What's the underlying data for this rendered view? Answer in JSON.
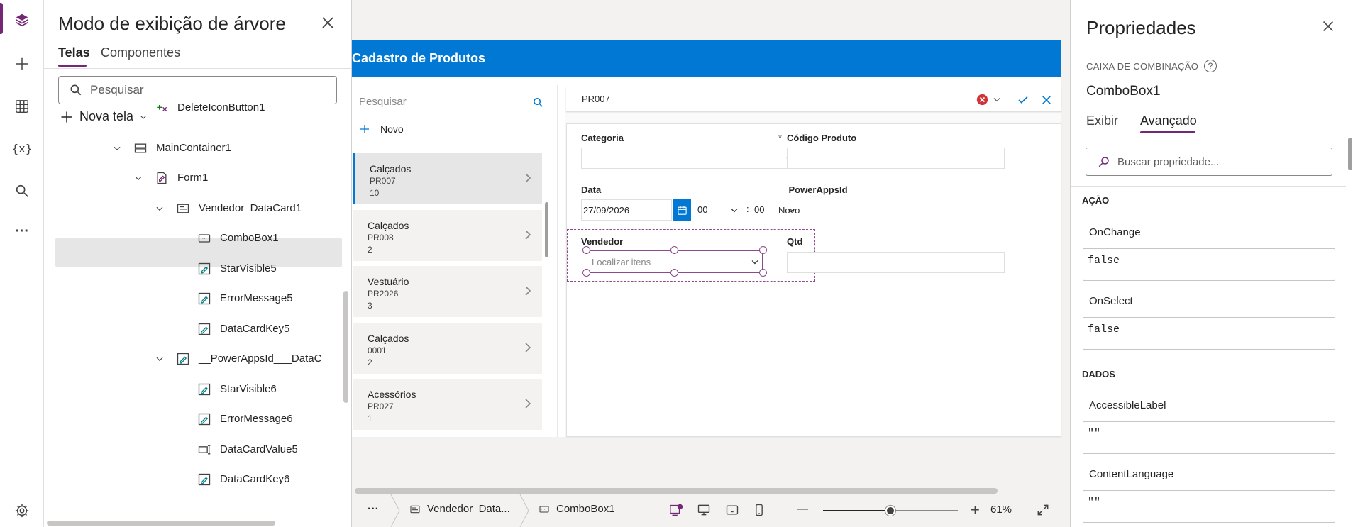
{
  "rail": {
    "icons": [
      "layers-icon",
      "plus-icon",
      "table-icon",
      "variable-icon",
      "search-icon",
      "more-icon",
      "settings-icon"
    ],
    "variable_label": "{x}",
    "more_label": "···"
  },
  "tree": {
    "title": "Modo de exibição de árvore",
    "tabs": [
      "Telas",
      "Componentes"
    ],
    "active_tab": "Telas",
    "search_placeholder": "Pesquisar",
    "new_screen": "Nova tela",
    "rows": [
      {
        "label": "DeleteIconButton1",
        "level": 7
      },
      {
        "label": "MainContainer1",
        "level": 6
      },
      {
        "label": "Form1",
        "level": 7
      },
      {
        "label": "Vendedor_DataCard1",
        "level": 8
      },
      {
        "label": "ComboBox1",
        "level": 9,
        "selected": true
      },
      {
        "label": "StarVisible5",
        "level": 9
      },
      {
        "label": "ErrorMessage5",
        "level": 9
      },
      {
        "label": "DataCardKey5",
        "level": 9
      },
      {
        "label": "__PowerAppsId___DataC",
        "level": 8
      },
      {
        "label": "StarVisible6",
        "level": 9
      },
      {
        "label": "ErrorMessage6",
        "level": 9
      },
      {
        "label": "DataCardValue5",
        "level": 9
      },
      {
        "label": "DataCardKey6",
        "level": 9
      }
    ]
  },
  "app_screen": {
    "header": "Cadastro de Produtos",
    "list_search_placeholder": "Pesquisar",
    "new_label": "Novo",
    "items": [
      {
        "title": "Calçados",
        "code": "PR007",
        "qty": "10"
      },
      {
        "title": "Calçados",
        "code": "PR008",
        "qty": "2"
      },
      {
        "title": "Vestuário",
        "code": "PR2026",
        "qty": "3"
      },
      {
        "title": "Calçados",
        "code": "0001",
        "qty": "2"
      },
      {
        "title": "Acessórios",
        "code": "PR027",
        "qty": "1"
      }
    ],
    "key_value": "PR007",
    "form": {
      "categoria_label": "Categoria",
      "codigo_label": "Código Produto",
      "required_mark": "*",
      "data_label": "Data",
      "date_value": "27/09/2026",
      "hour_value": "00",
      "minute_value": "00",
      "time_sep": ":",
      "powerappsid_label": "__PowerAppsId__",
      "powerappsid_value": "Novo",
      "vendedor_label": "Vendedor",
      "combo_placeholder": "Localizar itens",
      "qtd_label": "Qtd"
    }
  },
  "bottom_bar": {
    "more": "···",
    "breadcrumb": [
      "Vendedor_Data...",
      "ComboBox1"
    ],
    "zoom_minus": "—",
    "zoom_plus": "+",
    "zoom": "61%",
    "zoom_level_fraction": 0.5
  },
  "properties": {
    "title": "Propriedades",
    "type": "CAIXA DE COMBINAÇÃO",
    "help": "?",
    "name": "ComboBox1",
    "tabs": [
      "Exibir",
      "Avançado"
    ],
    "active_tab": "Avançado",
    "search_placeholder": "Buscar propriedade...",
    "sections": [
      {
        "name": "AÇÃO",
        "props": [
          {
            "label": "OnChange",
            "value": "false"
          },
          {
            "label": "OnSelect",
            "value": "false"
          }
        ]
      },
      {
        "name": "DADOS",
        "props": [
          {
            "label": "AccessibleLabel",
            "value": "\"\""
          },
          {
            "label": "ContentLanguage",
            "value": "\"\""
          }
        ]
      }
    ]
  },
  "colors": {
    "accent": "#742774",
    "header_blue": "#0078d4",
    "error_red": "#d13438"
  }
}
